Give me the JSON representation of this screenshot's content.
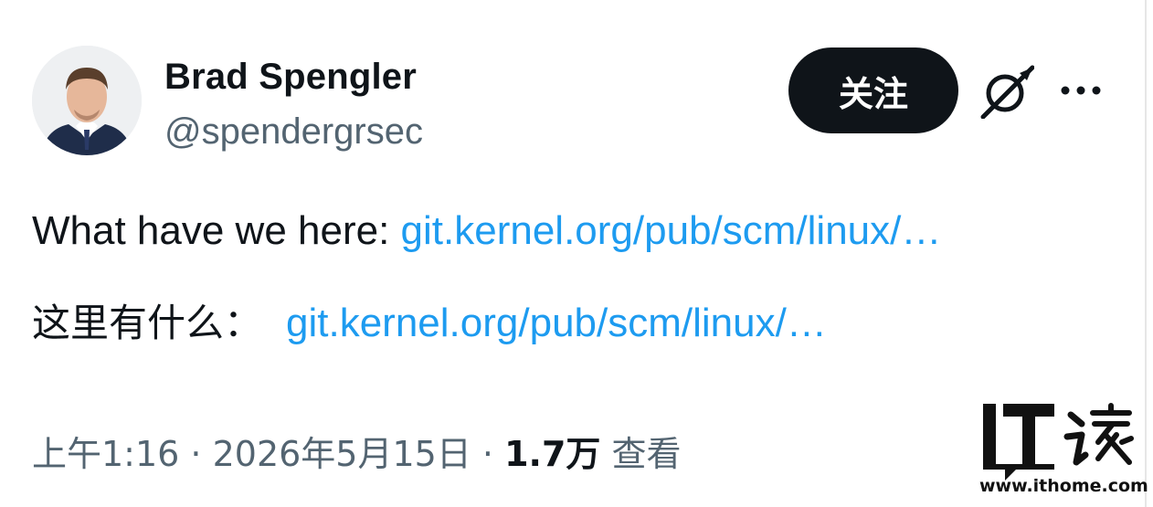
{
  "author": {
    "display_name": "Brad Spengler",
    "handle": "@spendergrsec"
  },
  "actions": {
    "follow_label": "关注",
    "grok_icon": "grok-icon",
    "more_icon": "more-icon"
  },
  "tweet": {
    "line1_text": "What have we here: ",
    "line1_link": "git.kernel.org/pub/scm/linux/…",
    "line2_text": "这里有什么：",
    "line2_link": "git.kernel.org/pub/scm/linux/…"
  },
  "meta": {
    "time": "上午1:16",
    "separator": " · ",
    "date": "2026年5月15日",
    "views_count": "1.7万",
    "views_label": " 查看"
  },
  "watermark": {
    "logo_letters": "IT",
    "logo_chars": "之家",
    "url": "www.ithome.com"
  },
  "colors": {
    "text_primary": "#0f1419",
    "text_secondary": "#536471",
    "link": "#1d9bf0",
    "button_bg": "#0f1419"
  }
}
